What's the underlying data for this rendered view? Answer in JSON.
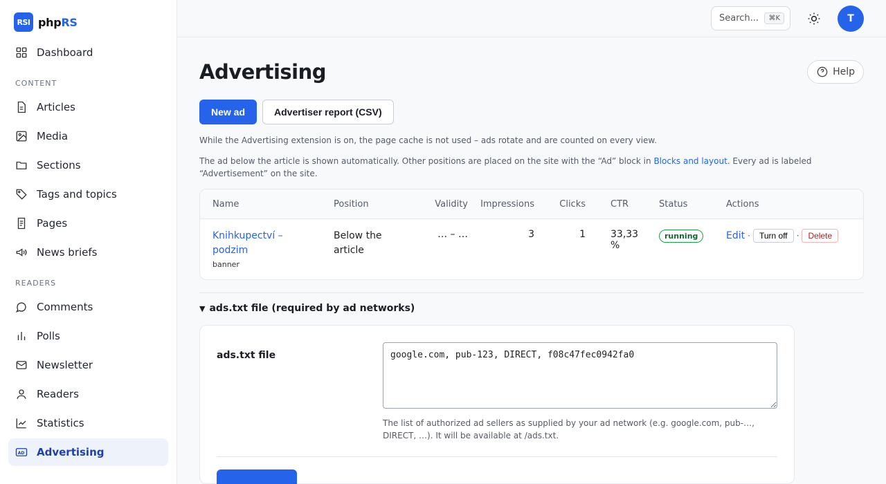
{
  "brand": {
    "logo": "RSI",
    "name_prefix": "php",
    "name_suffix": "RS"
  },
  "sidebar": {
    "dashboard": "Dashboard",
    "section_content": "CONTENT",
    "content_items": [
      "Articles",
      "Media",
      "Sections",
      "Tags and topics",
      "Pages",
      "News briefs"
    ],
    "section_readers": "READERS",
    "reader_items": [
      "Comments",
      "Polls",
      "Newsletter",
      "Readers",
      "Statistics",
      "Advertising"
    ]
  },
  "topbar": {
    "search_placeholder": "Search...",
    "search_shortcut": "⌘K",
    "avatar_initial": "T"
  },
  "page": {
    "title": "Advertising",
    "help_label": "Help"
  },
  "actions": {
    "new_ad": "New ad",
    "report": "Advertiser report (CSV)"
  },
  "info": {
    "line1": "While the Advertising extension is on, the page cache is not used – ads rotate and are counted on every view.",
    "line2_before": "The ad below the article is shown automatically. Other positions are placed on the site with the “Ad” block in ",
    "line2_link": "Blocks and layout",
    "line2_after": ". Every ad is labeled “Advertisement” on the site."
  },
  "table": {
    "headers": [
      "Name",
      "Position",
      "Validity",
      "Impressions",
      "Clicks",
      "CTR",
      "Status",
      "Actions"
    ],
    "rows": [
      {
        "name": "Knihkupectví – podzim",
        "type": "banner",
        "position": "Below the article",
        "validity": "… – …",
        "impressions": "3",
        "clicks": "1",
        "ctr": "33,33 %",
        "status": "running",
        "edit": "Edit",
        "toggle": "Turn off",
        "delete": "Delete"
      }
    ]
  },
  "adstxt": {
    "summary": "ads.txt file (required by ad networks)",
    "label": "ads.txt file",
    "value": "google.com, pub-123, DIRECT, f08c47fec0942fa0",
    "help": "The list of authorized ad sellers as supplied by your ad network (e.g. google.com, pub-…, DIRECT, …). It will be available at /ads.txt."
  },
  "colors": {
    "accent": "#2563eb",
    "status_running": "#16a34a",
    "danger": "#b91c1c"
  }
}
